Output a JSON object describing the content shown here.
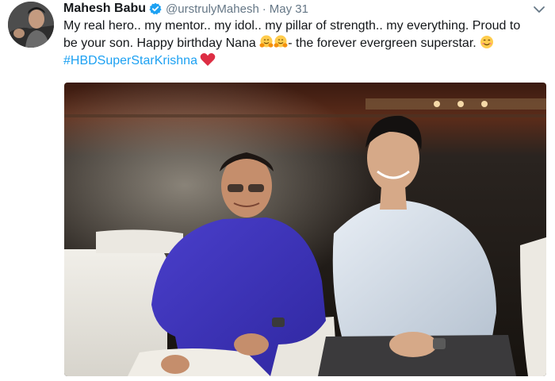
{
  "tweet": {
    "author": {
      "name": "Mahesh Babu",
      "handle": "@urstrulyMahesh",
      "verified": true
    },
    "separator": "·",
    "timestamp": "May 31",
    "text_line1": "My real hero.. my mentor.. my idol.. my pillar of strength.. my everything. Proud to",
    "text_line2_before_emoji": "be your son. Happy birthday Nana ",
    "text_line2_after_emoji": "- the forever evergreen superstar. ",
    "hashtag": "#HBDSuperStarKrishna",
    "icons": {
      "verified": "verified-badge-icon",
      "menu": "chevron-down-icon",
      "hug_emoji": "hugging-face-emoji",
      "smile_emoji": "smiling-face-emoji",
      "heart": "red-heart-icon"
    },
    "colors": {
      "link": "#1da1f2",
      "text": "#14171a",
      "secondary": "#657786",
      "heart": "#e0245e"
    }
  }
}
